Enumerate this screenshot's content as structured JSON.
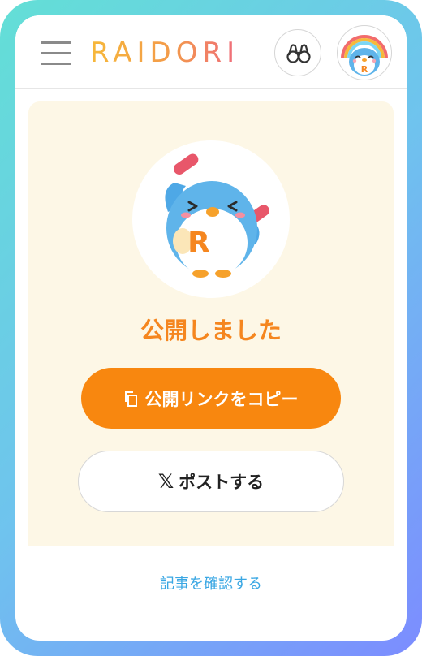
{
  "header": {
    "logo_text": "RAIDORI",
    "menu_icon": "hamburger-menu-icon",
    "search_icon": "binoculars-icon",
    "avatar_icon": "penguin-avatar-icon"
  },
  "main": {
    "mascot_icon": "cheering-penguin-mascot",
    "mascot_badge": "R",
    "status_title": "公開しました",
    "copy_button_label": "公開リンクをコピー",
    "copy_icon": "copy-icon",
    "post_button_label": "ポストする",
    "x_logo": "𝕏",
    "check_article_link": "記事を確認する"
  },
  "colors": {
    "accent_orange": "#f8870f",
    "card_background": "#fdf7e6",
    "link_blue": "#3aa7e3"
  }
}
